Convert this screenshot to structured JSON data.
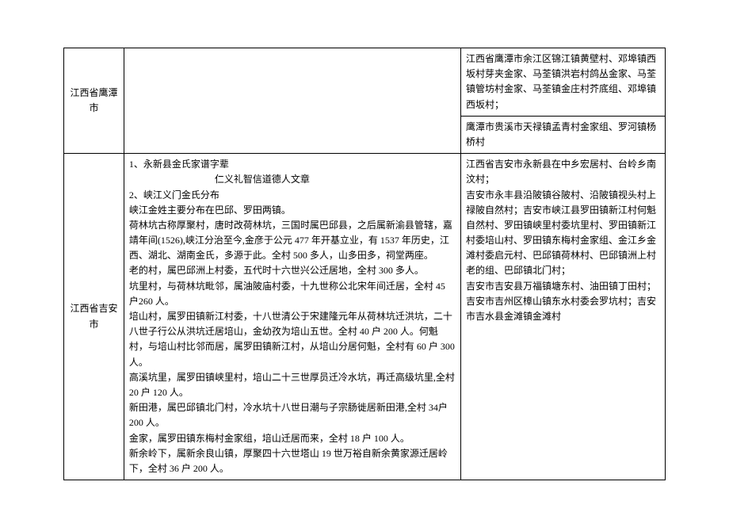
{
  "rows": [
    {
      "region": "江西省鹰潭市",
      "col2": "",
      "col3_a": "江西省鹰潭市余江区锦江镇黄壁村、邓埠镇西坂村芽夹金家、马荃镇洪岩村鸽丛金家、马荃镇管坊村金家、马荃镇金庄村芥底组、邓埠镇西坂村；",
      "col3_b": "鹰潭市贵溪市天禄镇孟青村金家组、罗河镇杨桥村"
    },
    {
      "region": "江西省吉安市",
      "col2_lines": [
        "1、永新县金氏家谱字辈",
        "　　　　　　　　　仁义礼智信道德人文章",
        "2、峡江义门金氏分布",
        "峡江金姓主要分布在巴邱、罗田两镇。",
        "荷林坑古称厚聚村，唐时改荷林坑，三国时属巴邱县，之后属新渝县管辖，嘉靖年间(1526),峡江分治至今,金彦于公元 477 年开基立业，有 1537 年历史，江西、湖北、湖南金氏，多源于此。全村 500 多人，山多田多，祠堂两座。",
        "老的村，属巴邱洲上村委，五代时十六世兴公迁居地，全村 300 多人。",
        "坑里村，与荷林坑毗邻，属油陂庙村委，十九世称公北宋年间迁居，全村 45 户260 人。",
        "培山村，属罗田镇新江村委，十八世清公于宋建隆元年从荷林坑迁洪坑，二十八世子行公从洪坑迁居培山，金幼孜为培山五世。全村 40 户 200 人。何魁村，与培山村比邻而居，属罗田镇新江村，从培山分居何魁，全村有 60 户 300 人。",
        "高溪坑里，属罗田镇峡里村，培山二十三世厚员迁冷水坑，再迁高级坑里,全村 20 户 120 人。",
        "新田港，属巴邱镇北门村，冷水坑十八世日潮与子宗肠徙居新田港,全村 34户 200 人。",
        "金家，属罗田镇东梅村金家组，培山迁居而来，全村 18 户 100 人。",
        "新余岭下，属新余良山镇，厚聚四十六世塔山 19 世万裕自新余黄家源迁居岭下，全村 36 户 200 人。"
      ],
      "col3": "江西省吉安市永新县在中乡宏居村、台岭乡南汶村；\n吉安市永丰县沿陂镇谷陂村、沿陂镇视头村上禄陂自然村；吉安市峡江县罗田镇新江村何魁自然村、罗田镇峡里村委坑里村、罗田镇新江村委培山村、罗田镇东梅村金家组、金江乡金滩村委启元村、巴邱镇荷林村、巴邱镇洲上村老的组、巴邱镇北门村；\n吉安市吉安县万福镇塘东村、油田镇丁田村；吉安市吉州区樟山镇东水村委会罗坑村；吉安市吉水县金滩镇金滩村"
    }
  ]
}
